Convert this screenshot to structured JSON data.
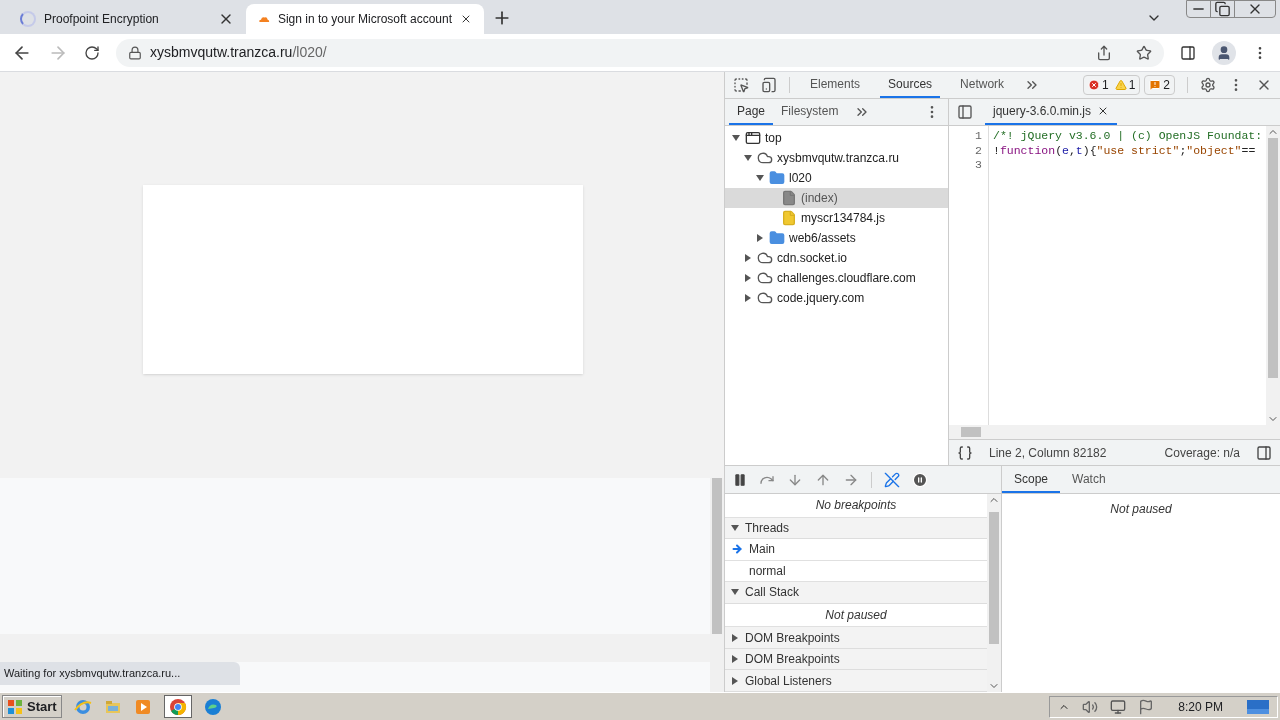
{
  "browser_tabs": [
    {
      "title": "Proofpoint Encryption",
      "selected": false
    },
    {
      "title": "Sign in to your Microsoft account",
      "selected": true
    }
  ],
  "address": {
    "host": "xysbmvqutw.tranzca.ru",
    "path": "/l020/"
  },
  "status_text": "Waiting for xysbmvqutw.tranzca.ru...",
  "devtools": {
    "panels": [
      {
        "label": "Elements",
        "selected": false
      },
      {
        "label": "Sources",
        "selected": true
      },
      {
        "label": "Network",
        "selected": false
      }
    ],
    "errors": "1",
    "warnings": "1",
    "issues": "2",
    "navigator_tabs": [
      {
        "label": "Page",
        "selected": true
      },
      {
        "label": "Filesystem",
        "selected": false
      }
    ],
    "tree": [
      {
        "label": "top",
        "kind": "frame",
        "expanded": true,
        "selected": false,
        "children": [
          {
            "label": "xysbmvqutw.tranzca.ru",
            "kind": "domain",
            "expanded": true,
            "selected": false,
            "children": [
              {
                "label": "l020",
                "kind": "folder",
                "expanded": true,
                "selected": false,
                "children": [
                  {
                    "label": "(index)",
                    "kind": "document",
                    "selected": true
                  },
                  {
                    "label": "myscr134784.js",
                    "kind": "script",
                    "selected": false
                  }
                ]
              },
              {
                "label": "web6/assets",
                "kind": "folder",
                "expanded": false,
                "selected": false
              }
            ]
          },
          {
            "label": "cdn.socket.io",
            "kind": "domain",
            "expanded": false,
            "selected": false
          },
          {
            "label": "challenges.cloudflare.com",
            "kind": "domain",
            "expanded": false,
            "selected": false
          },
          {
            "label": "code.jquery.com",
            "kind": "domain",
            "expanded": false,
            "selected": false
          }
        ]
      }
    ],
    "open_file": "jquery-3.6.0.min.js",
    "code_lines": [
      {
        "number": "1",
        "tokens": [
          {
            "kind": "comment",
            "text": "/*! jQuery v3.6.0 | (c) OpenJS Foundat:"
          }
        ]
      },
      {
        "number": "2",
        "tokens": [
          {
            "kind": "plain",
            "text": "!"
          },
          {
            "kind": "keyword",
            "text": "function"
          },
          {
            "kind": "plain",
            "text": "("
          },
          {
            "kind": "variable",
            "text": "e"
          },
          {
            "kind": "plain",
            "text": ","
          },
          {
            "kind": "variable",
            "text": "t"
          },
          {
            "kind": "plain",
            "text": "){"
          },
          {
            "kind": "string",
            "text": "\"use strict\""
          },
          {
            "kind": "plain",
            "text": ";"
          },
          {
            "kind": "string",
            "text": "\"object\""
          },
          {
            "kind": "plain",
            "text": "=="
          }
        ]
      },
      {
        "number": "3"
      }
    ],
    "cursor": "Line 2, Column 82182",
    "coverage": "Coverage: n/a",
    "debug_rows": [
      {
        "kind": "message",
        "text": "No breakpoints"
      },
      {
        "kind": "header",
        "text": "Threads",
        "expanded": true
      },
      {
        "kind": "thread",
        "text": "Main",
        "selected": true
      },
      {
        "kind": "thread",
        "text": "normal",
        "selected": false
      },
      {
        "kind": "header",
        "text": "Call Stack",
        "expanded": true
      },
      {
        "kind": "message",
        "text": "Not paused"
      },
      {
        "kind": "header",
        "text": "DOM Breakpoints",
        "expanded": false
      },
      {
        "kind": "header",
        "text": "DOM Breakpoints",
        "expanded": false
      },
      {
        "kind": "header",
        "text": "Global Listeners",
        "expanded": false
      }
    ],
    "scope_tabs": [
      {
        "label": "Scope",
        "selected": true
      },
      {
        "label": "Watch",
        "selected": false
      }
    ],
    "scope_message": "Not paused"
  },
  "taskbar": {
    "start": "Start",
    "clock": "8:20 PM"
  }
}
